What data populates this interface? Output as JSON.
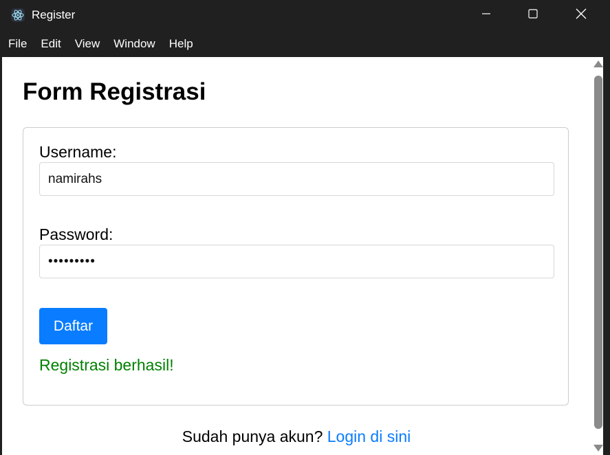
{
  "window": {
    "title": "Register",
    "icon": "electron-atom-icon"
  },
  "menubar": {
    "items": [
      "File",
      "Edit",
      "View",
      "Window",
      "Help"
    ]
  },
  "page": {
    "title": "Form Registrasi"
  },
  "form": {
    "username_label": "Username:",
    "username_value": "namirahs",
    "password_label": "Password:",
    "password_value": "•••••••••",
    "submit_label": "Daftar",
    "success_message": "Registrasi berhasil!"
  },
  "footer": {
    "prompt": "Sudah punya akun? ",
    "link_label": "Login di sini"
  },
  "colors": {
    "accent": "#0a7cff",
    "success": "#008000",
    "titlebar": "#202020"
  }
}
